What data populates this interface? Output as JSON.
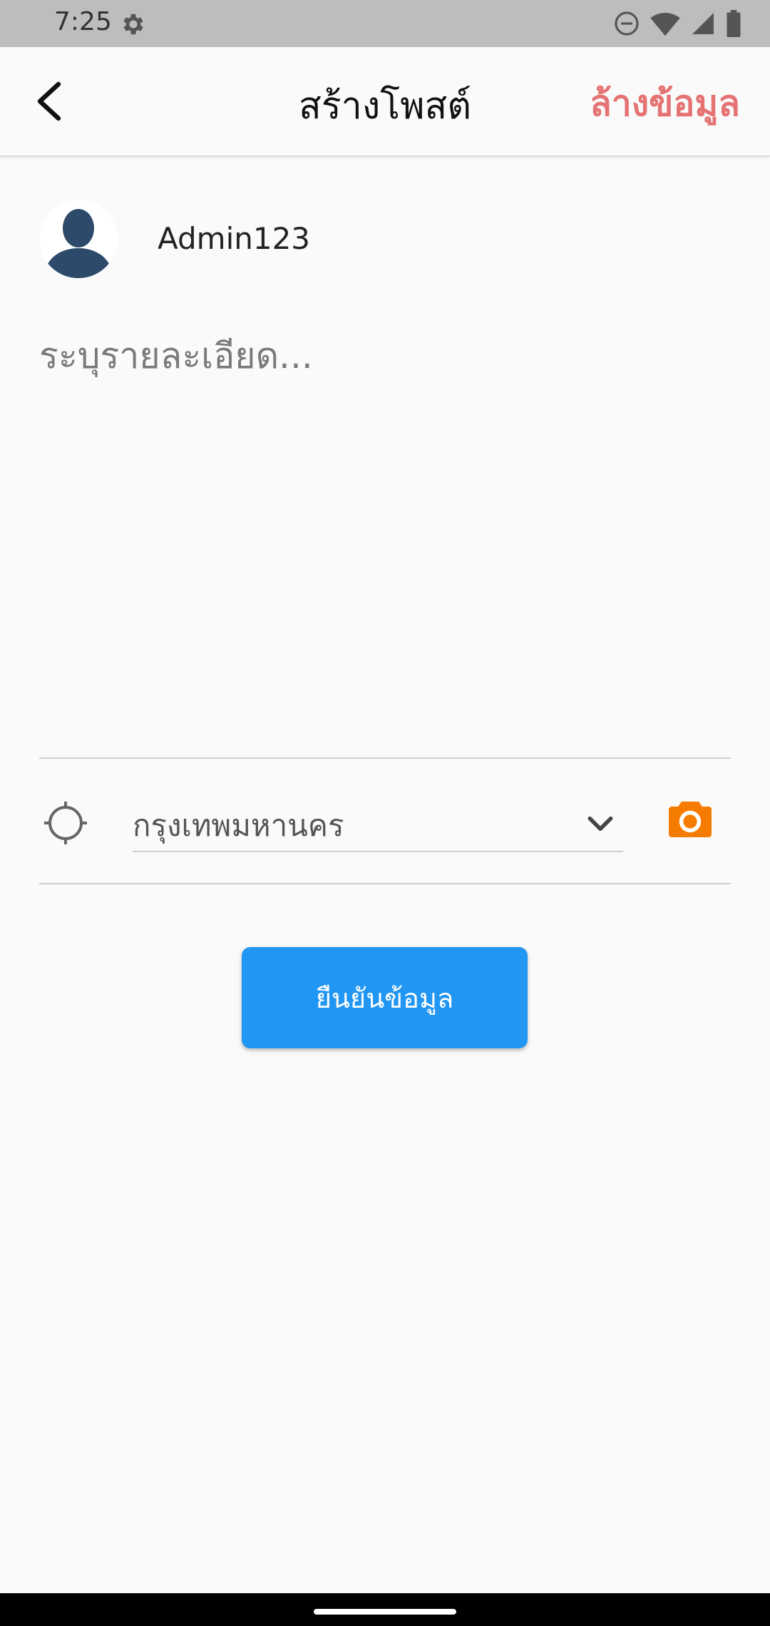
{
  "status_bar": {
    "time": "7:25",
    "icons": [
      "settings-icon",
      "dnd-icon",
      "wifi-icon",
      "signal-icon",
      "battery-icon"
    ]
  },
  "app_bar": {
    "title": "สร้างโพสต์",
    "clear_label": "ล้างข้อมูล",
    "back_icon": "back-arrow-icon"
  },
  "user": {
    "name": "Admin123",
    "avatar_icon": "person-silhouette-icon"
  },
  "post": {
    "description_value": "",
    "description_placeholder": "ระบุรายละเอียด..."
  },
  "location": {
    "icon": "crosshair-icon",
    "selected": "กรุงเทพมหานคร",
    "dropdown_icon": "chevron-down-icon",
    "camera_icon": "camera-icon"
  },
  "actions": {
    "confirm_label": "ยืนยันข้อมูล"
  },
  "colors": {
    "accent_blue": "#2196f3",
    "clear_red": "#e57373",
    "camera_orange": "#f57c00",
    "avatar_navy": "#2e4a6b"
  }
}
